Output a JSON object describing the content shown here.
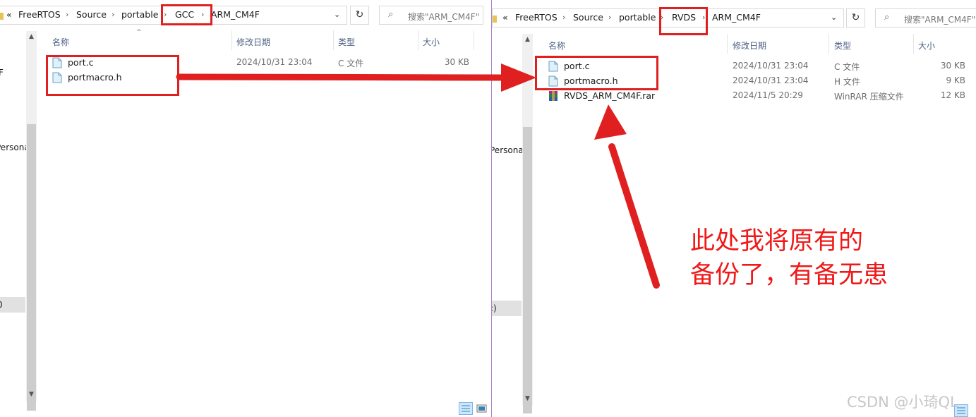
{
  "left": {
    "breadcrumb": {
      "prefix": "«",
      "items": [
        "FreeRTOS",
        "Source",
        "portable",
        "GCC",
        "ARM_CM4F"
      ]
    },
    "search_placeholder": "搜索\"ARM_CM4F\"",
    "nav_fragments": [
      "F",
      "Persona",
      "0"
    ],
    "columns": {
      "name": "名称",
      "date": "修改日期",
      "type": "类型",
      "size": "大小"
    },
    "files": [
      {
        "name": "port.c",
        "date": "2024/10/31 23:04",
        "type": "C 文件",
        "size": "30 KB"
      },
      {
        "name": "portmacro.h",
        "date": "",
        "type": "",
        "size": ""
      }
    ]
  },
  "right": {
    "breadcrumb": {
      "prefix": "«",
      "items": [
        "FreeRTOS",
        "Source",
        "portable",
        "RVDS",
        "ARM_CM4F"
      ]
    },
    "search_placeholder": "搜索\"ARM_CM4F\"",
    "nav_fragments": [
      "Persona",
      ":)"
    ],
    "columns": {
      "name": "名称",
      "date": "修改日期",
      "type": "类型",
      "size": "大小"
    },
    "files": [
      {
        "name": "port.c",
        "date": "2024/10/31 23:04",
        "type": "C 文件",
        "size": "30 KB"
      },
      {
        "name": "portmacro.h",
        "date": "2024/10/31 23:04",
        "type": "H 文件",
        "size": "9 KB"
      },
      {
        "name": "RVDS_ARM_CM4F.rar",
        "date": "2024/11/5 20:29",
        "type": "WinRAR 压缩文件",
        "size": "12 KB"
      }
    ]
  },
  "annotation": {
    "line1": "此处我将原有的",
    "line2": "备份了，有备无患"
  },
  "watermark": "CSDN @小琦QL",
  "colors": {
    "annotation_red": "#e02020",
    "header_text": "#4d6185",
    "selection_gray": "#e1e1e1"
  },
  "icons": [
    "folder-icon",
    "refresh-icon",
    "search-icon",
    "dropdown-chevron-icon",
    "text-file-icon",
    "winrar-archive-icon",
    "details-view-icon",
    "large-icons-view-icon"
  ]
}
